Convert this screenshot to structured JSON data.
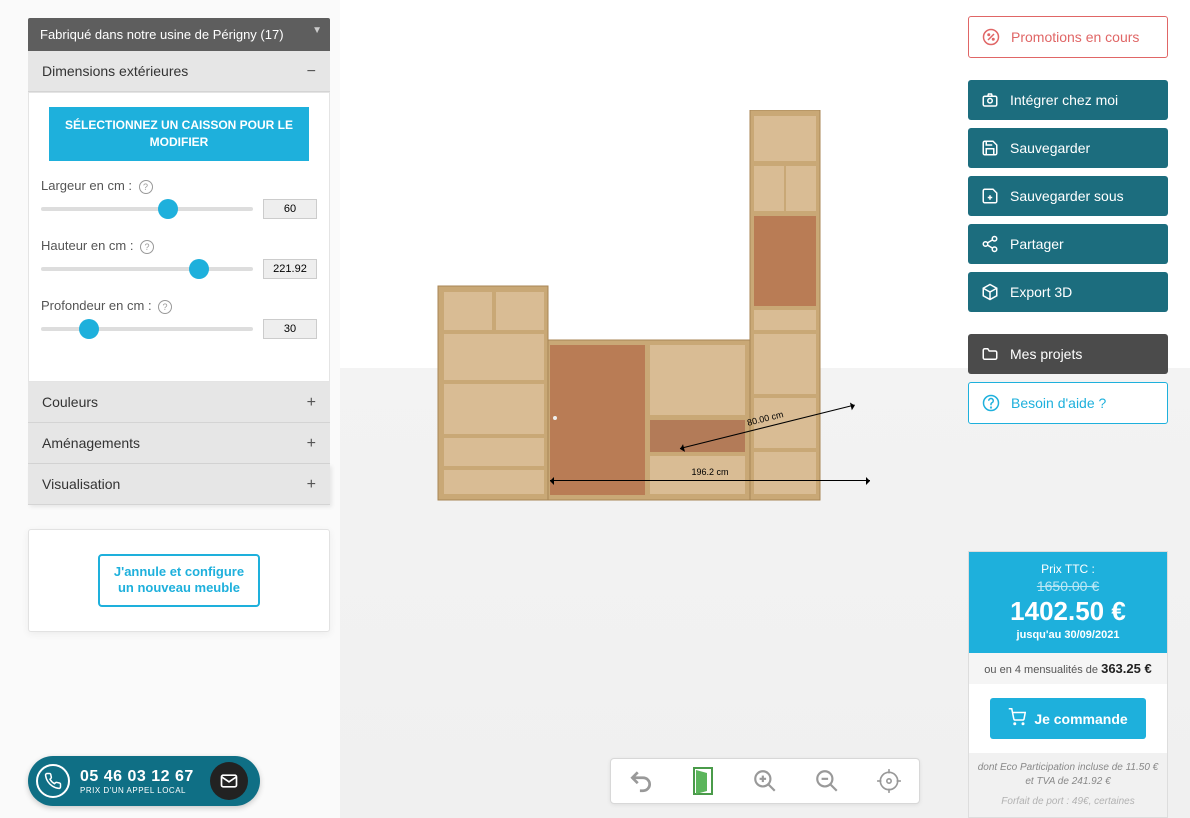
{
  "header": "Fabriqué dans notre usine de Périgny (17)",
  "sections": {
    "dimensions": {
      "title": "Dimensions extérieures",
      "open": true
    },
    "colors": {
      "title": "Couleurs"
    },
    "layouts": {
      "title": "Aménagements"
    },
    "viz": {
      "title": "Visualisation"
    }
  },
  "dim_panel": {
    "select_btn": "SÉLECTIONNEZ UN CAISSON POUR LE MODIFIER",
    "width": {
      "label": "Largeur en cm :",
      "value": "60",
      "percent": 55
    },
    "height": {
      "label": "Hauteur en cm :",
      "value": "221.92",
      "percent": 70
    },
    "depth": {
      "label": "Profondeur en cm :",
      "value": "30",
      "percent": 18
    }
  },
  "cancel_btn": "J'annule et configure\nun nouveau meuble",
  "right": {
    "promo": "Promotions en cours",
    "integrate": "Intégrer chez moi",
    "save": "Sauvegarder",
    "save_as": "Sauvegarder sous",
    "share": "Partager",
    "export3d": "Export 3D",
    "projects": "Mes projets",
    "help": "Besoin d'aide ?"
  },
  "price": {
    "label": "Prix TTC :",
    "old": "1650.00 €",
    "main": "1402.50 €",
    "until": "jusqu'au 30/09/2021",
    "installment_pre": "ou en 4 mensualités de",
    "installment_val": "363.25 €",
    "order": "Je commande",
    "eco": "dont Eco Participation incluse de 11.50 € et TVA de 241.92 €",
    "ship": "Forfait de port : 49€, certaines"
  },
  "phone": {
    "number": "05 46 03 12 67",
    "sub": "PRIX D'UN APPEL LOCAL"
  },
  "viewport": {
    "width_label": "196.2 cm",
    "depth_label": "80.00 cm"
  }
}
